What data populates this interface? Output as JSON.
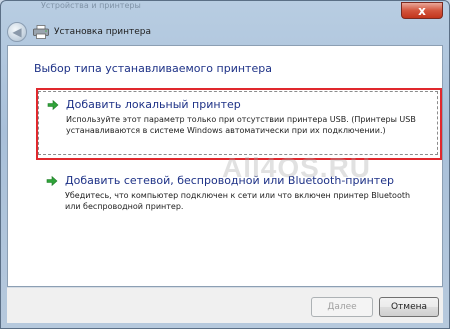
{
  "window": {
    "close_label": "x",
    "bg_caption": "Устройства и принтеры"
  },
  "titlebar": {
    "back_icon": "back-arrow-icon",
    "printer_icon": "printer-icon",
    "title": "Установка принтера"
  },
  "content": {
    "heading": "Выбор типа устанавливаемого принтера",
    "options": [
      {
        "icon": "green-arrow-icon",
        "title": "Добавить локальный принтер",
        "description": "Используйте этот параметр только при отсутствии принтера USB. (Принтеры USB устанавливаются в системе Windows автоматически при их подключении.)"
      },
      {
        "icon": "green-arrow-icon",
        "title": "Добавить сетевой, беспроводной или Bluetooth-принтер",
        "description": "Убедитесь, что компьютер подключен к сети или что включен принтер Bluetooth или беспроводной принтер."
      }
    ],
    "watermark": "All4OS.RU",
    "highlight_color": "#e0282d"
  },
  "footer": {
    "next_label": "Далее",
    "cancel_label": "Отмена"
  }
}
